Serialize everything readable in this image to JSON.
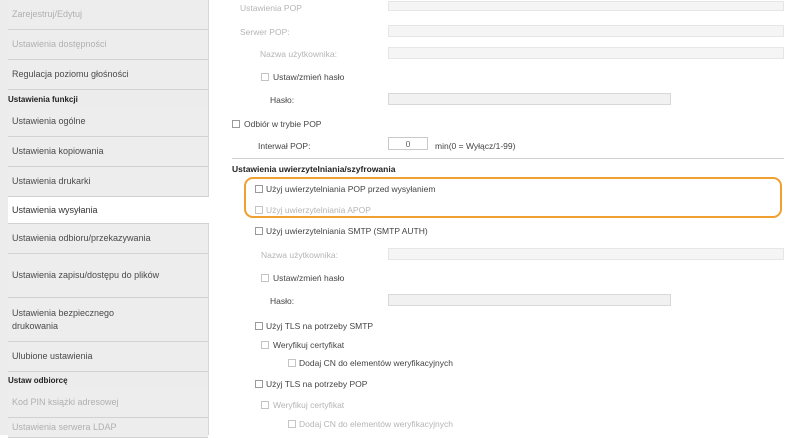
{
  "sidebar": {
    "items": [
      {
        "label": "Zarejestruj/Edytuj",
        "faded": true
      },
      {
        "label": "Ustawienia dostępności",
        "faded": true
      },
      {
        "label": "Regulacja poziomu głośności",
        "faded": false
      }
    ],
    "header_functions": "Ustawienia funkcji",
    "function_items": [
      "Ustawienia ogólne",
      "Ustawienia kopiowania",
      "Ustawienia drukarki",
      "Ustawienia wysyłania",
      "Ustawienia odbioru/przekazywania",
      "Ustawienia zapisu/dostępu do plików",
      "Ustawienia bezpiecznego drukowania",
      "Ulubione ustawienia"
    ],
    "active_item": "Ustawienia wysyłania",
    "header_recipient": "Ustaw odbiorcę",
    "recipient_items": [
      "Kod PIN książki adresowej",
      "Ustawienia serwera LDAP"
    ]
  },
  "main": {
    "top_faded_label": "Ustawienia POP",
    "pop_server_label": "Serwer POP:",
    "username_label": "Nazwa użytkownika:",
    "set_change_password_label": "Ustaw/zmień hasło",
    "password_label": "Hasło:",
    "pop_receive_label": "Odbiór w trybie POP",
    "pop_interval_label": "Interwał POP:",
    "pop_interval_value": "0",
    "pop_interval_unit": "min(0 = Wyłącz/1-99)",
    "auth_section_title": "Ustawienia uwierzytelniania/szyfrowania",
    "use_pop_before_send": "Użyj uwierzytelniania POP przed wysyłaniem",
    "use_apop": "Użyj uwierzytelniania APOP",
    "use_smtp_auth": "Użyj uwierzytelniania SMTP (SMTP AUTH)",
    "smtp_username_label": "Nazwa użytkownika:",
    "smtp_set_change_password": "Ustaw/zmień hasło",
    "smtp_password_label": "Hasło:",
    "use_tls_smtp": "Użyj TLS na potrzeby SMTP",
    "verify_cert_smtp": "Weryfikuj certyfikat",
    "add_cn_smtp": "Dodaj CN do elementów weryfikacyjnych",
    "use_tls_pop": "Użyj TLS na potrzeby POP",
    "verify_cert_pop": "Weryfikuj certyfikat",
    "add_cn_pop": "Dodaj CN do elementów weryfikacyjnych"
  },
  "colors": {
    "highlight": "#f0a030",
    "sidebar_bg": "#ececec",
    "active_bg": "#ffffff"
  }
}
